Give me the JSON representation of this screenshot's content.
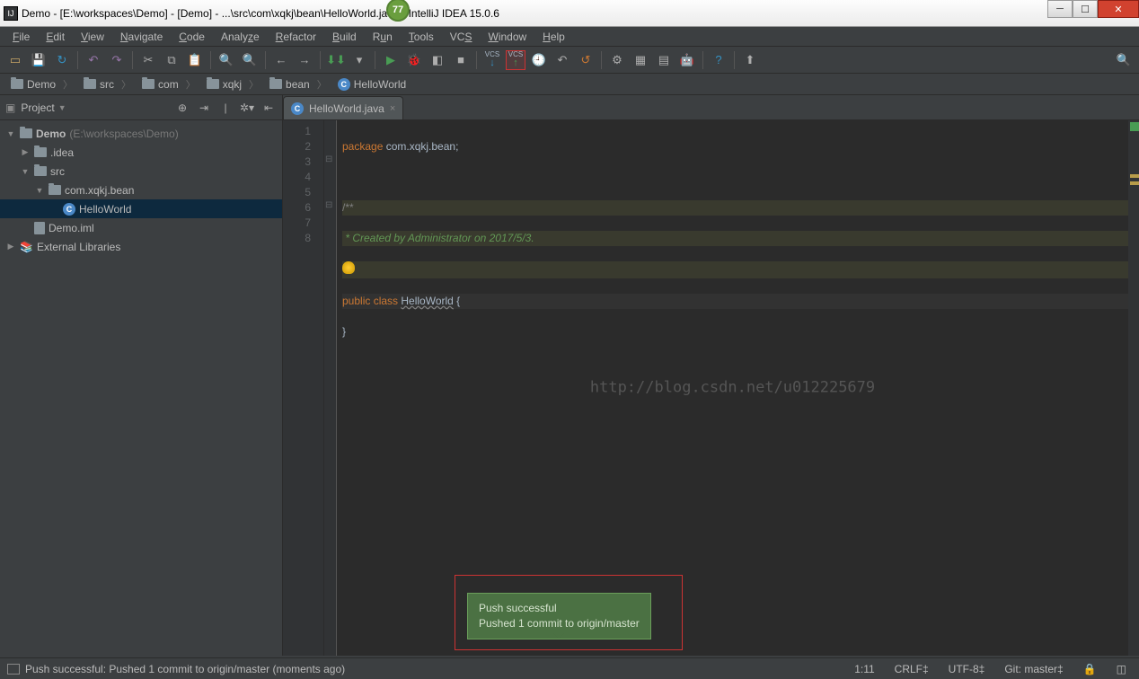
{
  "title": "Demo - [E:\\workspaces\\Demo] - [Demo] - ...\\src\\com\\xqkj\\bean\\HelloWorld.java - IntelliJ IDEA 15.0.6",
  "badge": "77",
  "menu": [
    "File",
    "Edit",
    "View",
    "Navigate",
    "Code",
    "Analyze",
    "Refactor",
    "Build",
    "Run",
    "Tools",
    "VCS",
    "Window",
    "Help"
  ],
  "breadcrumbs": [
    {
      "icon": "folder",
      "label": "Demo"
    },
    {
      "icon": "folder",
      "label": "src"
    },
    {
      "icon": "folder",
      "label": "com"
    },
    {
      "icon": "folder",
      "label": "xqkj"
    },
    {
      "icon": "folder",
      "label": "bean"
    },
    {
      "icon": "class",
      "label": "HelloWorld"
    }
  ],
  "sidebar": {
    "header": "Project",
    "items": [
      {
        "depth": 0,
        "tw": "▼",
        "icon": "folder",
        "label": "Demo",
        "suffix": " (E:\\workspaces\\Demo)",
        "bold": true
      },
      {
        "depth": 1,
        "tw": "▶",
        "icon": "folder",
        "label": ".idea"
      },
      {
        "depth": 1,
        "tw": "▼",
        "icon": "folder",
        "label": "src"
      },
      {
        "depth": 2,
        "tw": "▼",
        "icon": "folder",
        "label": "com.xqkj.bean"
      },
      {
        "depth": 3,
        "tw": "",
        "icon": "class",
        "label": "HelloWorld",
        "sel": true
      },
      {
        "depth": 1,
        "tw": "",
        "icon": "file",
        "label": "Demo.iml"
      },
      {
        "depth": 0,
        "tw": "▶",
        "icon": "lib",
        "label": "External Libraries"
      }
    ]
  },
  "tab": {
    "label": "HelloWorld.java"
  },
  "code": {
    "lines": [
      "1",
      "2",
      "3",
      "4",
      "5",
      "6",
      "7",
      "8"
    ],
    "package_kw": "package",
    "package_name": " com.xqkj.bean;",
    "jd_open": "/**",
    "jd_body": " * Created by Administrator on 2017/5/3.",
    "jd_close": " */",
    "public_kw": "public ",
    "class_kw": "class ",
    "class_name": "HelloWorld",
    "brace_open": " {",
    "brace_close": "}"
  },
  "watermark": "http://blog.csdn.net/u012225679",
  "notification": {
    "line1": "Push successful",
    "line2": "Pushed 1 commit to origin/master"
  },
  "status": {
    "msg": "Push successful: Pushed 1 commit to origin/master (moments ago)",
    "pos": "1:11",
    "sep": "CRLF‡",
    "enc": "UTF-8‡",
    "git": "Git: master‡"
  }
}
